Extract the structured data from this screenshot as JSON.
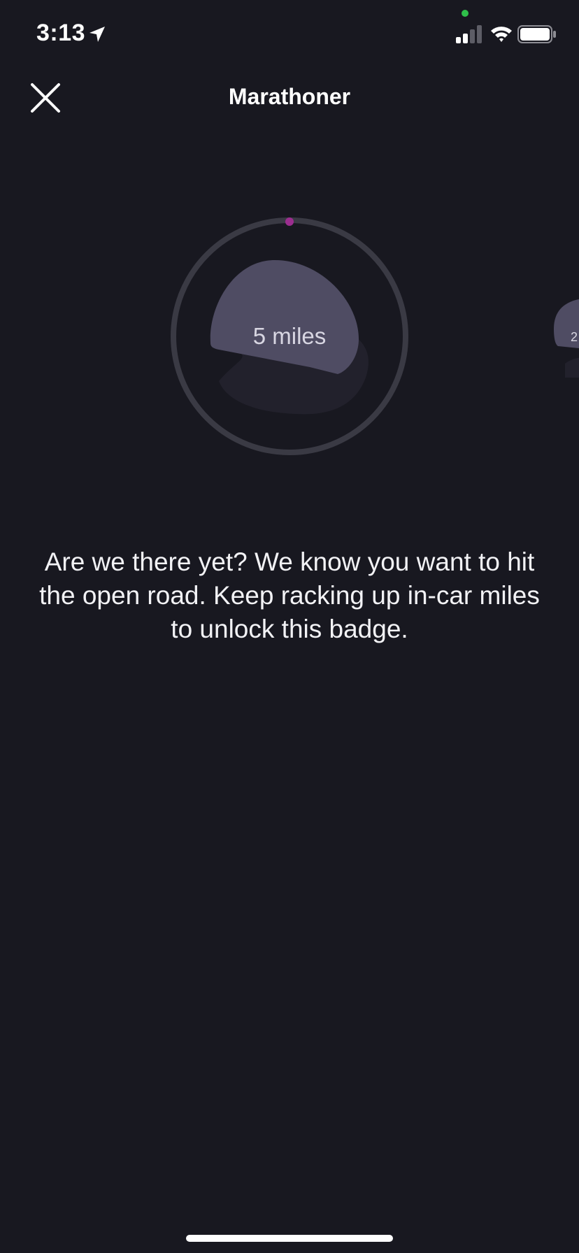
{
  "status_bar": {
    "time": "3:13",
    "icons": [
      "location-arrow-icon",
      "signal-icon",
      "wifi-icon",
      "battery-icon"
    ],
    "privacy_dot_color": "#2fbf4a"
  },
  "header": {
    "close_icon": "close-icon",
    "title": "Marathoner"
  },
  "badge": {
    "label": "5 miles",
    "progress": 0,
    "progress_color": "#9b2d8f",
    "ring_color": "#3a3a44",
    "shape_color": "#4f4c63",
    "shadow_color": "#22212c"
  },
  "next_badge": {
    "label": "2"
  },
  "description": {
    "text": "Are we there yet? We know you want to hit the open road. Keep racking up in-car miles to unlock this badge."
  },
  "colors": {
    "background": "#181820",
    "text": "#ffffff"
  }
}
